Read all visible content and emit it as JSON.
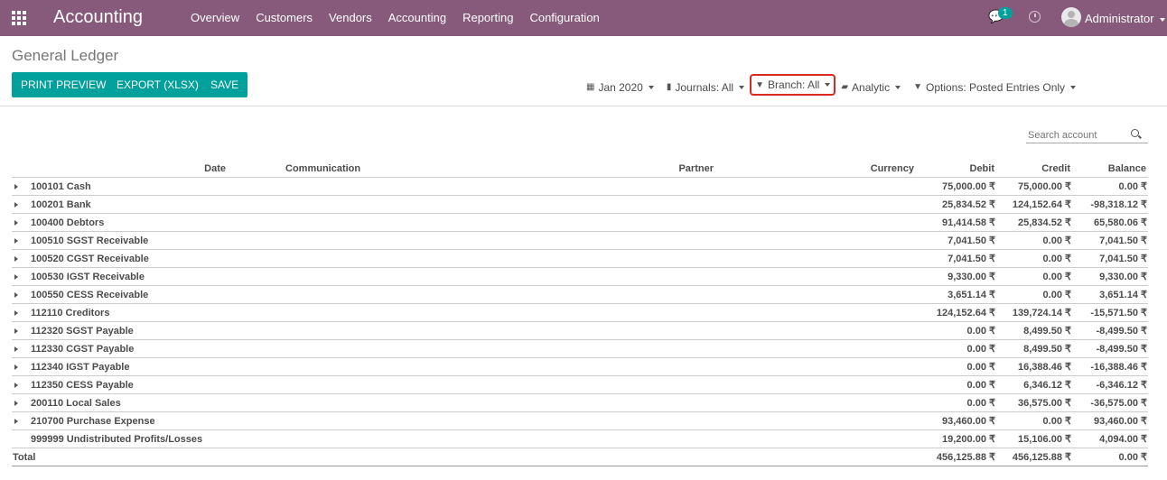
{
  "navbar": {
    "app_name": "Accounting",
    "menu": [
      "Overview",
      "Customers",
      "Vendors",
      "Accounting",
      "Reporting",
      "Configuration"
    ],
    "chat_count": "1",
    "user": "Administrator",
    "bg_color": "#875a7b"
  },
  "page": {
    "title": "General Ledger"
  },
  "buttons": {
    "print": "PRINT PREVIEW",
    "export": "EXPORT (XLSX)",
    "save": "SAVE",
    "color": "#00a09d"
  },
  "filters": {
    "date": "Jan 2020",
    "journals": "Journals: All",
    "branch": "Branch: All",
    "analytic": "Analytic",
    "options": "Options: Posted Entries Only"
  },
  "search": {
    "placeholder": "Search account"
  },
  "table": {
    "headers": [
      "Date",
      "Communication",
      "Partner",
      "Currency",
      "Debit",
      "Credit",
      "Balance"
    ],
    "rows": [
      {
        "account": "100101 Cash",
        "debit": "75,000.00 ₹",
        "credit": "75,000.00 ₹",
        "balance": "0.00 ₹",
        "expand": true
      },
      {
        "account": "100201 Bank",
        "debit": "25,834.52 ₹",
        "credit": "124,152.64 ₹",
        "balance": "-98,318.12 ₹",
        "expand": true
      },
      {
        "account": "100400 Debtors",
        "debit": "91,414.58 ₹",
        "credit": "25,834.52 ₹",
        "balance": "65,580.06 ₹",
        "expand": true
      },
      {
        "account": "100510 SGST Receivable",
        "debit": "7,041.50 ₹",
        "credit": "0.00 ₹",
        "balance": "7,041.50 ₹",
        "expand": true
      },
      {
        "account": "100520 CGST Receivable",
        "debit": "7,041.50 ₹",
        "credit": "0.00 ₹",
        "balance": "7,041.50 ₹",
        "expand": true
      },
      {
        "account": "100530 IGST Receivable",
        "debit": "9,330.00 ₹",
        "credit": "0.00 ₹",
        "balance": "9,330.00 ₹",
        "expand": true
      },
      {
        "account": "100550 CESS Receivable",
        "debit": "3,651.14 ₹",
        "credit": "0.00 ₹",
        "balance": "3,651.14 ₹",
        "expand": true
      },
      {
        "account": "112110 Creditors",
        "debit": "124,152.64 ₹",
        "credit": "139,724.14 ₹",
        "balance": "-15,571.50 ₹",
        "expand": true
      },
      {
        "account": "112320 SGST Payable",
        "debit": "0.00 ₹",
        "credit": "8,499.50 ₹",
        "balance": "-8,499.50 ₹",
        "expand": true
      },
      {
        "account": "112330 CGST Payable",
        "debit": "0.00 ₹",
        "credit": "8,499.50 ₹",
        "balance": "-8,499.50 ₹",
        "expand": true
      },
      {
        "account": "112340 IGST Payable",
        "debit": "0.00 ₹",
        "credit": "16,388.46 ₹",
        "balance": "-16,388.46 ₹",
        "expand": true
      },
      {
        "account": "112350 CESS Payable",
        "debit": "0.00 ₹",
        "credit": "6,346.12 ₹",
        "balance": "-6,346.12 ₹",
        "expand": true
      },
      {
        "account": "200110 Local Sales",
        "debit": "0.00 ₹",
        "credit": "36,575.00 ₹",
        "balance": "-36,575.00 ₹",
        "expand": true
      },
      {
        "account": "210700 Purchase Expense",
        "debit": "93,460.00 ₹",
        "credit": "0.00 ₹",
        "balance": "93,460.00 ₹",
        "expand": true
      },
      {
        "account": "999999 Undistributed Profits/Losses",
        "debit": "19,200.00 ₹",
        "credit": "15,106.00 ₹",
        "balance": "4,094.00 ₹",
        "expand": false
      }
    ],
    "total": {
      "label": "Total",
      "debit": "456,125.88 ₹",
      "credit": "456,125.88 ₹",
      "balance": "0.00 ₹"
    }
  }
}
